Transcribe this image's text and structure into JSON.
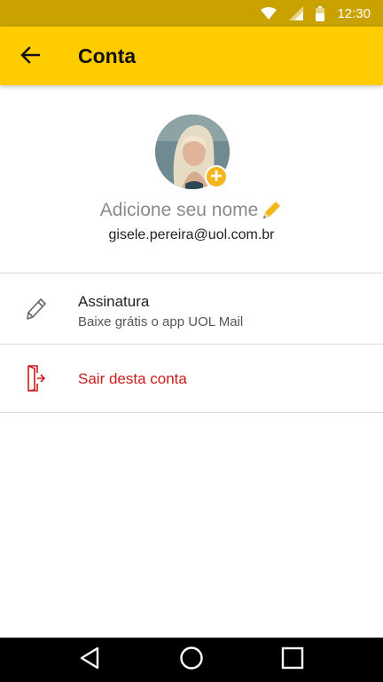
{
  "status_bar": {
    "time": "12:30",
    "icons": [
      "wifi-icon",
      "signal-icon",
      "battery-icon"
    ]
  },
  "app_bar": {
    "back_icon": "arrow-left-icon",
    "title": "Conta",
    "background_color": "#ffcc00"
  },
  "profile": {
    "avatar_icon": "user-photo",
    "add_photo_icon": "plus-icon",
    "name_placeholder": "Adicione seu nome",
    "edit_icon": "pencil-icon",
    "email": "gisele.pereira@uol.com.br"
  },
  "menu": {
    "signature": {
      "icon": "pencil-outline-icon",
      "title": "Assinatura",
      "subtitle": "Baixe grátis o app UOL Mail"
    },
    "logout": {
      "icon": "exit-door-icon",
      "label": "Sair desta conta",
      "color": "#cc1b1b"
    }
  },
  "nav_bar": {
    "buttons": [
      "back-triangle-icon",
      "home-circle-icon",
      "recents-square-icon"
    ]
  }
}
